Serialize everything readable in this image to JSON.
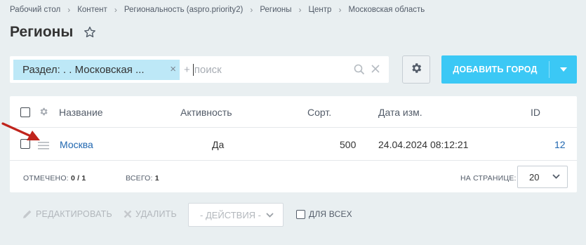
{
  "breadcrumb": [
    "Рабочий стол",
    "Контент",
    "Региональность (aspro.priority2)",
    "Регионы",
    "Центр",
    "Московская область"
  ],
  "page_title": "Регионы",
  "filter": {
    "chip_label": "Раздел: . . Московская ...",
    "plus": "+",
    "placeholder": "поиск"
  },
  "add_button": {
    "label": "ДОБАВИТЬ ГОРОД"
  },
  "table": {
    "columns": {
      "name": "Название",
      "active": "Активность",
      "sort": "Сорт.",
      "date": "Дата изм.",
      "id": "ID"
    },
    "rows": [
      {
        "name": "Москва",
        "active": "Да",
        "sort": "500",
        "date": "24.04.2024 08:12:21",
        "id": "12"
      }
    ]
  },
  "footer": {
    "selected_label": "ОТМЕЧЕНО:",
    "selected_value": "0 / 1",
    "total_label": "ВСЕГО:",
    "total_value": "1",
    "per_page_label": "НА СТРАНИЦЕ:",
    "per_page_value": "20"
  },
  "actions": {
    "edit": "РЕДАКТИРОВАТЬ",
    "delete": "УДАЛИТЬ",
    "select_placeholder": "- ДЕЙСТВИЯ -",
    "for_all": "ДЛЯ ВСЕХ"
  },
  "colors": {
    "background": "#e9eff1",
    "accent": "#3bc8f5",
    "chip": "#bde8f7",
    "link": "#2067b0",
    "annotation_arrow": "#c0241c"
  }
}
